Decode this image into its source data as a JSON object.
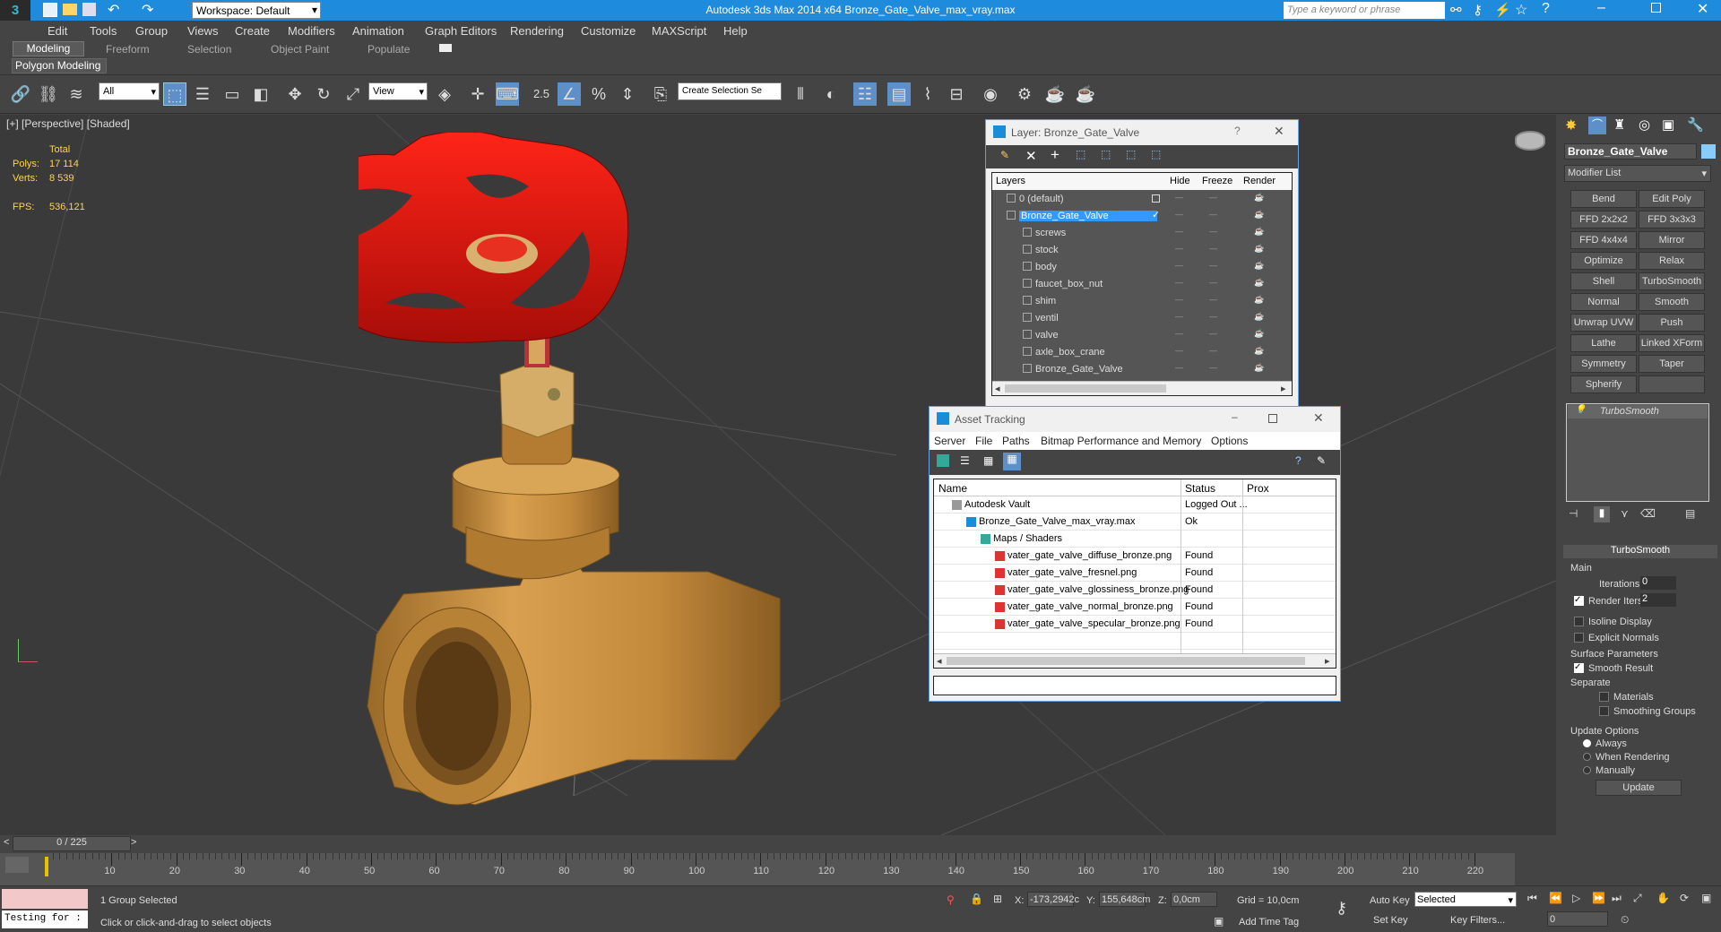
{
  "app": {
    "title": "Autodesk 3ds Max  2014 x64     Bronze_Gate_Valve_max_vray.max",
    "workspace": "Workspace: Default",
    "search_placeholder": "Type a keyword or phrase"
  },
  "menu": [
    "Edit",
    "Tools",
    "Group",
    "Views",
    "Create",
    "Modifiers",
    "Animation",
    "Graph Editors",
    "Rendering",
    "Customize",
    "MAXScript",
    "Help"
  ],
  "ribbon": {
    "tabs": [
      "Modeling",
      "Freeform",
      "Selection",
      "Object Paint",
      "Populate"
    ],
    "sub": "Polygon Modeling"
  },
  "toolbar": {
    "filter": "All",
    "refcoord": "View",
    "snap_value": "2.5",
    "selset": "Create Selection Se"
  },
  "viewport": {
    "label": "[+] [Perspective] [Shaded]",
    "stats": {
      "total": "Total",
      "polys_label": "Polys:",
      "polys": "17 114",
      "verts_label": "Verts:",
      "verts": "8 539",
      "fps_label": "FPS:",
      "fps": "536,121"
    }
  },
  "layer_win": {
    "title": "Layer: Bronze_Gate_Valve",
    "col_layers": "Layers",
    "col_hide": "Hide",
    "col_freeze": "Freeze",
    "col_render": "Render",
    "rows": [
      "0 (default)",
      "Bronze_Gate_Valve",
      "screws",
      "stock",
      "body",
      "faucet_box_nut",
      "shim",
      "ventil",
      "valve",
      "axle_box_crane",
      "Bronze_Gate_Valve"
    ]
  },
  "asset_win": {
    "title": "Asset Tracking",
    "menu": [
      "Server",
      "File",
      "Paths",
      "Bitmap Performance and Memory",
      "Options"
    ],
    "col_name": "Name",
    "col_status": "Status",
    "col_prox": "Prox",
    "rows": [
      {
        "name": "Autodesk Vault",
        "status": "Logged Out ..."
      },
      {
        "name": "Bronze_Gate_Valve_max_vray.max",
        "status": "Ok"
      },
      {
        "name": "Maps / Shaders",
        "status": ""
      },
      {
        "name": "vater_gate_valve_diffuse_bronze.png",
        "status": "Found"
      },
      {
        "name": "vater_gate_valve_fresnel.png",
        "status": "Found"
      },
      {
        "name": "vater_gate_valve_glossiness_bronze.png",
        "status": "Found"
      },
      {
        "name": "vater_gate_valve_normal_bronze.png",
        "status": "Found"
      },
      {
        "name": "vater_gate_valve_specular_bronze.png",
        "status": "Found"
      }
    ]
  },
  "cmdpanel": {
    "objname": "Bronze_Gate_Valve",
    "modlist": "Modifier List",
    "buttons": [
      "Bend",
      "Edit Poly",
      "FFD 2x2x2",
      "FFD 3x3x3",
      "FFD 4x4x4",
      "Mirror",
      "Optimize",
      "Relax",
      "Shell",
      "TurboSmooth",
      "Normal",
      "Smooth",
      "Unwrap UVW",
      "Push",
      "Lathe",
      "Linked XForm",
      "Symmetry",
      "Taper",
      "Spherify",
      ""
    ],
    "stack_item": "TurboSmooth",
    "rollout": "TurboSmooth",
    "main": "Main",
    "iterations_label": "Iterations:",
    "iterations": "0",
    "render_iters_label": "Render Iters:",
    "render_iters": "2",
    "isoline": "Isoline Display",
    "explicit": "Explicit Normals",
    "surface": "Surface Parameters",
    "smooth_result": "Smooth Result",
    "separate": "Separate",
    "materials": "Materials",
    "smoothing_groups": "Smoothing Groups",
    "update_options": "Update Options",
    "always": "Always",
    "when_rendering": "When Rendering",
    "manually": "Manually",
    "update": "Update"
  },
  "timeline": {
    "frame": "0 / 225",
    "ticks": [
      "10",
      "20",
      "30",
      "40",
      "50",
      "60",
      "70",
      "80",
      "90",
      "100",
      "110",
      "120",
      "130",
      "140",
      "150",
      "160",
      "170",
      "180",
      "190",
      "200",
      "210",
      "220"
    ]
  },
  "status": {
    "selected": "1 Group Selected",
    "prompt": "Click or click-and-drag to select objects",
    "script": "Testing for :",
    "x_label": "X:",
    "x": "-173,2942c",
    "y_label": "Y:",
    "y": "155,648cm",
    "z_label": "Z:",
    "z": "0,0cm",
    "grid": "Grid = 10,0cm",
    "add_time_tag": "Add Time Tag",
    "auto_key": "Auto Key",
    "set_key": "Set Key",
    "key_mode": "Selected",
    "key_filters": "Key Filters...",
    "frame_value": "0"
  },
  "colors": {
    "titlebar": "#1f8bdc",
    "handle": "#e0140f",
    "body": "#c8903d",
    "selection": "#3399ff"
  }
}
